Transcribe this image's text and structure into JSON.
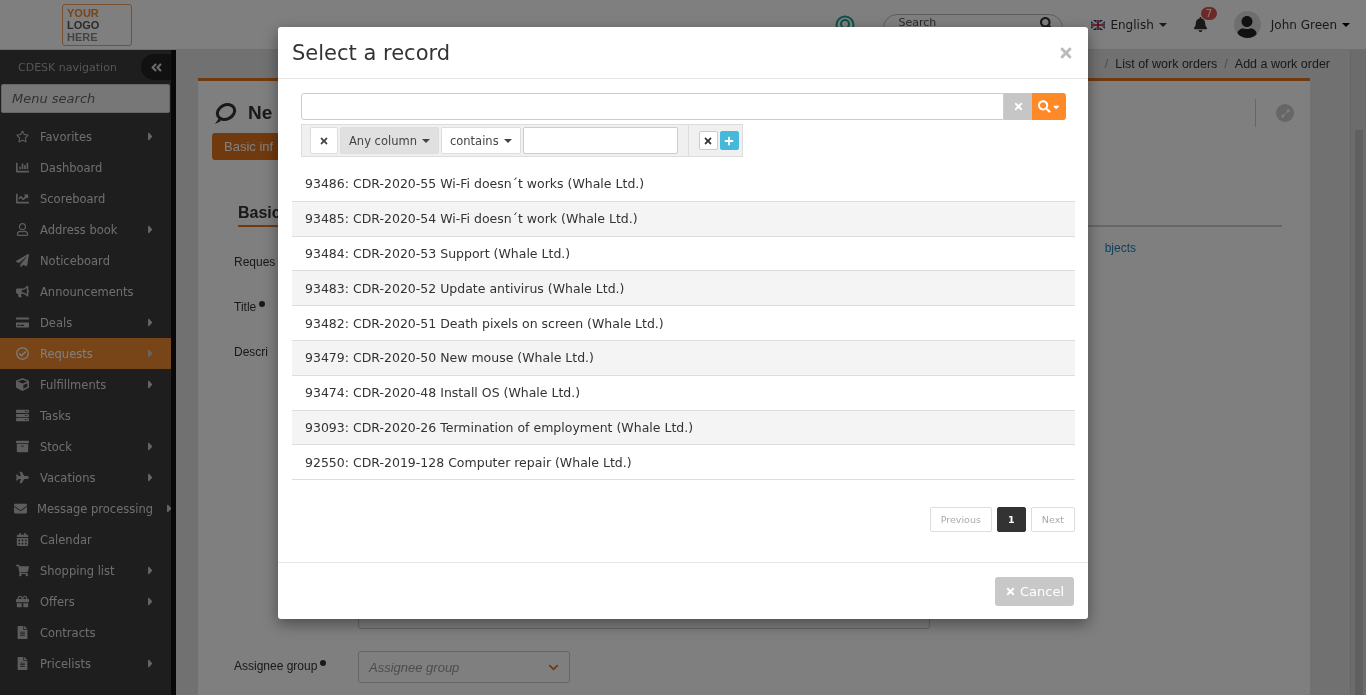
{
  "topbar": {
    "logo": {
      "word_1": "YOUR",
      "word_2": "LOGO",
      "word_3": "HERE"
    },
    "search": {
      "placeholder": "Search"
    },
    "language": "English",
    "notifications": {
      "count": "7"
    },
    "user": "John Green"
  },
  "sidebar": {
    "title": "CDESK navigation",
    "search": {
      "placeholder": "Menu search"
    },
    "items": [
      {
        "label": "Favorites",
        "has_submenu": true,
        "selected": false
      },
      {
        "label": "Dashboard",
        "has_submenu": false,
        "selected": false
      },
      {
        "label": "Scoreboard",
        "has_submenu": false,
        "selected": false
      },
      {
        "label": "Address book",
        "has_submenu": true,
        "selected": false
      },
      {
        "label": "Noticeboard",
        "has_submenu": false,
        "selected": false
      },
      {
        "label": "Announcements",
        "has_submenu": false,
        "selected": false
      },
      {
        "label": "Deals",
        "has_submenu": true,
        "selected": false
      },
      {
        "label": "Requests",
        "has_submenu": true,
        "selected": true
      },
      {
        "label": "Fulfillments",
        "has_submenu": true,
        "selected": false
      },
      {
        "label": "Tasks",
        "has_submenu": false,
        "selected": false
      },
      {
        "label": "Stock",
        "has_submenu": true,
        "selected": false
      },
      {
        "label": "Vacations",
        "has_submenu": true,
        "selected": false
      },
      {
        "label": "Message processing",
        "has_submenu": true,
        "selected": false
      },
      {
        "label": "Calendar",
        "has_submenu": false,
        "selected": false
      },
      {
        "label": "Shopping list",
        "has_submenu": true,
        "selected": false
      },
      {
        "label": "Offers",
        "has_submenu": true,
        "selected": false
      },
      {
        "label": "Contracts",
        "has_submenu": false,
        "selected": false
      },
      {
        "label": "Pricelists",
        "has_submenu": true,
        "selected": false
      }
    ]
  },
  "breadcrumbs": [
    {
      "separator": "/",
      "label": "List of work orders"
    },
    {
      "separator": "/",
      "label": "Add a work order"
    }
  ],
  "page": {
    "title": "Ne",
    "tab": "Basic inf",
    "section": "Basic",
    "link": "bjects",
    "fields": [
      {
        "label": "Reques",
        "required": false
      },
      {
        "label": "Title",
        "required": true
      },
      {
        "label": "Descri",
        "required": false
      }
    ],
    "assignee_group": {
      "label": "Assignee group",
      "required": true,
      "placeholder": "Assignee group"
    }
  },
  "modal": {
    "title": "Select a record",
    "filter": {
      "column": "Any column",
      "operator": "contains"
    },
    "records": [
      "93486: CDR-2020-55 Wi-Fi doesn´t works (Whale Ltd.)",
      "93485: CDR-2020-54 Wi-Fi doesn´t work (Whale Ltd.)",
      "93484: CDR-2020-53 Support (Whale Ltd.)",
      "93483: CDR-2020-52 Update antivirus (Whale Ltd.)",
      "93482: CDR-2020-51 Death pixels on screen (Whale Ltd.)",
      "93479: CDR-2020-50 New mouse (Whale Ltd.)",
      "93474: CDR-2020-48 Install OS (Whale Ltd.)",
      "93093: CDR-2020-26 Termination of employment (Whale Ltd.)",
      "92550: CDR-2019-128 Computer repair (Whale Ltd.)"
    ],
    "pagination": {
      "previous": {
        "label": "Previous",
        "disabled": true
      },
      "pages": [
        {
          "label": "1",
          "selected": true
        }
      ],
      "next": {
        "label": "Next",
        "disabled": true
      }
    },
    "cancel": {
      "label": "Cancel",
      "disabled": true
    }
  }
}
